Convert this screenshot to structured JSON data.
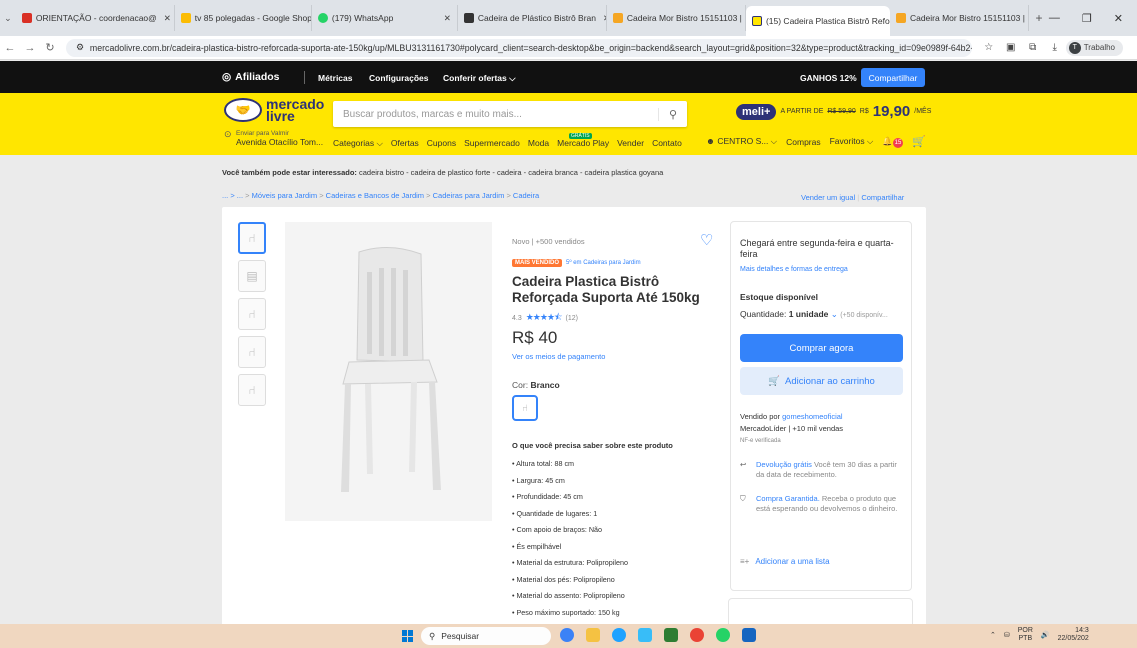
{
  "browser": {
    "tabs": [
      {
        "label": "ORIENTAÇÃO - coordenacao@",
        "color": "#d93025"
      },
      {
        "label": "tv 85 polegadas - Google Shop",
        "color": "#fbbc04"
      },
      {
        "label": "(179) WhatsApp",
        "color": "#25d366"
      },
      {
        "label": "Cadeira de Plástico Bistrô Bran",
        "color": "#333333"
      },
      {
        "label": "Cadeira Mor Bistro 15151103 |",
        "color": "#f5a623"
      },
      {
        "label": "(15) Cadeira Plastica Bistrô Refo",
        "color": "#ffe600"
      },
      {
        "label": "Cadeira Mor Bistro 15151103 |",
        "color": "#f5a623"
      }
    ],
    "new_tab": "+",
    "url": "mercadolivre.com.br/cadeira-plastica-bistro-reforcada-suporta-ate-150kg/up/MLBU3131161730#polycard_client=search-desktop&be_origin=backend&search_layout=grid&position=32&type=product&tracking_id=09e0989f-64b2-...",
    "profile": "Trabalho",
    "profile_initial": "T"
  },
  "affiliates": {
    "logo": "Afiliados",
    "menu": [
      "Métricas",
      "Configurações",
      "Conferir ofertas ⌵"
    ],
    "gains": "GANHOS 12%",
    "share": "Compartilhar"
  },
  "header": {
    "brand_line1": "mercado",
    "brand_line2": "livre",
    "search_placeholder": "Buscar produtos, marcas e muito mais...",
    "meli_pill": "meli+",
    "meli_from": "A PARTIR DE",
    "meli_old": "R$ 59,90",
    "meli_currency": "R$",
    "meli_price": "19,90",
    "meli_per": "/MÊS",
    "ship_label": "Enviar para Valmir",
    "ship_address": "Avenida Otacílio Tom...",
    "categories": [
      "Categorias ⌵",
      "Ofertas",
      "Cupons",
      "Supermercado",
      "Moda",
      "Mercado Play",
      "Vender",
      "Contato"
    ],
    "gratis": "GRÁTIS",
    "user": "CENTRO S... ⌵",
    "compras": "Compras",
    "favoritos": "Favoritos ⌵",
    "notif_count": "15"
  },
  "page": {
    "also_label": "Você também pode estar interessado:",
    "also_links": "cadeira bistro - cadeira de plastico forte - cadeira - cadeira branca - cadeira plastica goyana",
    "breadcrumb": [
      "... > ...",
      ">",
      "Móveis para Jardim",
      ">",
      "Cadeiras e Bancos de Jardim",
      ">",
      "Cadeiras para Jardim",
      ">",
      "Cadeira"
    ],
    "sell_similar": "Vender um igual",
    "share": "Compartilhar"
  },
  "product": {
    "condition": "Novo | +500 vendidos",
    "badge": "MAIS VENDIDO",
    "badge_cat": "5º em Cadeiras para Jardim",
    "title": "Cadeira Plastica Bistrô Reforçada Suporta Até 150kg",
    "rating_value": "4.3",
    "stars": "★★★★⯪",
    "rating_count": "(12)",
    "price": "R$ 40",
    "payment_link": "Ver os meios de pagamento",
    "color_label": "Cor:",
    "color_value": "Branco",
    "features_title": "O que você precisa saber sobre este produto",
    "features": [
      "Altura total: 88 cm",
      "Largura: 45 cm",
      "Profundidade: 45 cm",
      "Quantidade de lugares: 1",
      "Com apoio de braços: Não",
      "És empilhável",
      "Material da estrutura: Polipropileno",
      "Material dos pés: Polipropileno",
      "Material do assento: Polipropileno",
      "Peso máximo suportado: 150 kg"
    ]
  },
  "buybox": {
    "shipping": "Chegará entre segunda-feira e quarta-feira",
    "details_link": "Mais detalhes e formas de entrega",
    "stock": "Estoque disponível",
    "qty_label": "Quantidade:",
    "qty_value": "1 unidade",
    "qty_available": "(+50 disponív...",
    "buy_now": "Comprar agora",
    "add_cart": "Adicionar ao carrinho",
    "sold_by": "Vendido por",
    "seller": "gomeshomeoficial",
    "seller_level": "MercadoLíder | +10 mil vendas",
    "nf": "NF-e verificada",
    "return_link": "Devolução grátis",
    "return_text": "Você tem 30 dias a partir da data de recebimento.",
    "guarantee_link": "Compra Garantida.",
    "guarantee_text": "Receba o produto que está esperando ou devolvemos o dinheiro.",
    "add_list": "Adicionar a uma lista"
  },
  "taskbar": {
    "search": "Pesquisar",
    "lang1": "POR",
    "lang2": "PTB",
    "time": "14:3",
    "date": "22/05/202"
  }
}
